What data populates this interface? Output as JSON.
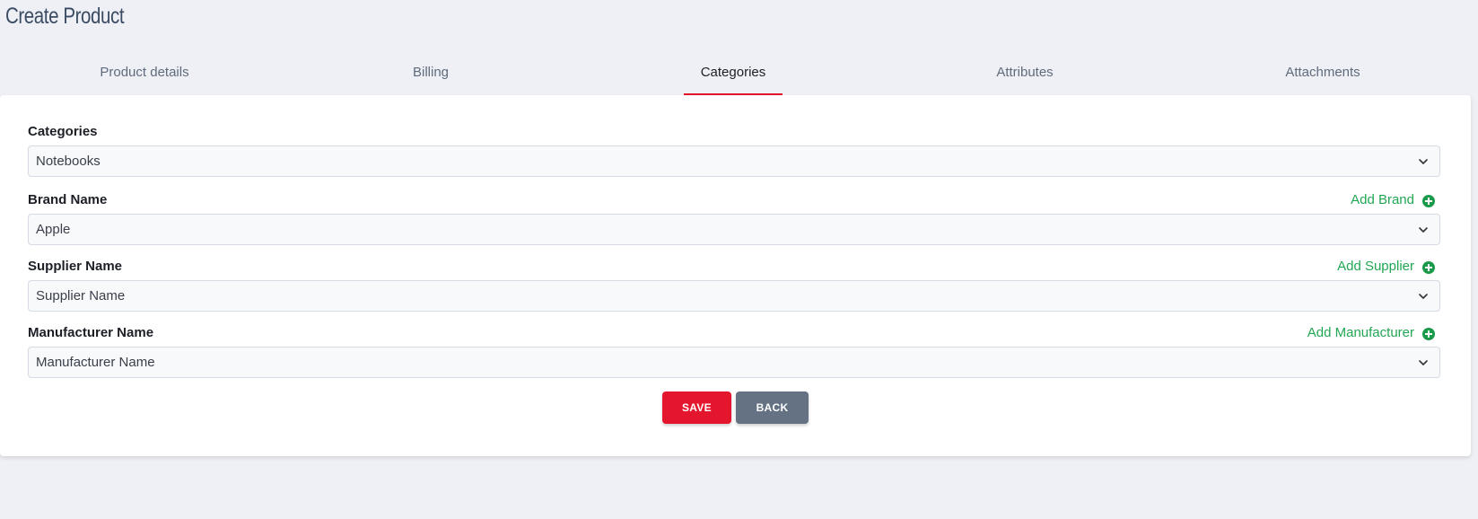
{
  "page": {
    "title": "Create Product"
  },
  "tabs": [
    {
      "label": "Product details",
      "active": false
    },
    {
      "label": "Billing",
      "active": false
    },
    {
      "label": "Categories",
      "active": true
    },
    {
      "label": "Attributes",
      "active": false
    },
    {
      "label": "Attachments",
      "active": false
    }
  ],
  "form": {
    "categories": {
      "label": "Categories",
      "value": "Notebooks"
    },
    "brand": {
      "label": "Brand Name",
      "value": "Apple",
      "add_label": "Add Brand"
    },
    "supplier": {
      "label": "Supplier Name",
      "value": "Supplier Name",
      "add_label": "Add Supplier"
    },
    "manufacturer": {
      "label": "Manufacturer Name",
      "value": "Manufacturer Name",
      "add_label": "Add Manufacturer"
    }
  },
  "actions": {
    "save_label": "SAVE",
    "back_label": "BACK"
  },
  "colors": {
    "accent": "#e4162e",
    "add_link": "#22a653",
    "back_button": "#647284",
    "background": "#eff0f5"
  },
  "icons": {
    "add": "plus-circle-icon",
    "dropdown": "chevron-down-icon"
  }
}
